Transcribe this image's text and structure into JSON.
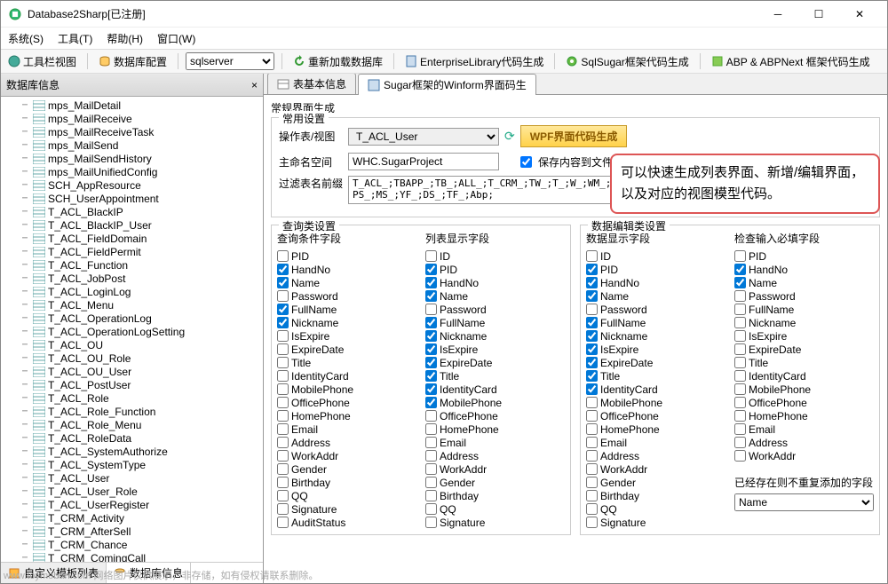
{
  "titlebar": {
    "title": "Database2Sharp[已注册]"
  },
  "menubar": {
    "items": [
      "系统(S)",
      "工具(T)",
      "帮助(H)",
      "窗口(W)"
    ]
  },
  "toolbar": {
    "toolbar_view": "工具栏视图",
    "db_config": "数据库配置",
    "db_select_value": "sqlserver",
    "reload_db": "重新加载数据库",
    "enterprise": "EnterpriseLibrary代码生成",
    "sqlsugar": "SqlSugar框架代码生成",
    "abp": "ABP & ABPNext 框架代码生成"
  },
  "sidebar": {
    "header": "数据库信息",
    "items": [
      "mps_MailDetail",
      "mps_MailReceive",
      "mps_MailReceiveTask",
      "mps_MailSend",
      "mps_MailSendHistory",
      "mps_MailUnifiedConfig",
      "SCH_AppResource",
      "SCH_UserAppointment",
      "T_ACL_BlackIP",
      "T_ACL_BlackIP_User",
      "T_ACL_FieldDomain",
      "T_ACL_FieldPermit",
      "T_ACL_Function",
      "T_ACL_JobPost",
      "T_ACL_LoginLog",
      "T_ACL_Menu",
      "T_ACL_OperationLog",
      "T_ACL_OperationLogSetting",
      "T_ACL_OU",
      "T_ACL_OU_Role",
      "T_ACL_OU_User",
      "T_ACL_PostUser",
      "T_ACL_Role",
      "T_ACL_Role_Function",
      "T_ACL_Role_Menu",
      "T_ACL_RoleData",
      "T_ACL_SystemAuthorize",
      "T_ACL_SystemType",
      "T_ACL_User",
      "T_ACL_User_Role",
      "T_ACL_UserRegister",
      "T_CRM_Activity",
      "T_CRM_AfterSell",
      "T_CRM_Chance",
      "T_CRM_ComingCall"
    ],
    "footer_tabs": {
      "custom_template": "自定义模板列表",
      "db_info": "数据库信息"
    }
  },
  "tabs": {
    "basic": "表基本信息",
    "sugar": "Sugar框架的Winform界面码生"
  },
  "panel": {
    "section_title": "常规界面生成",
    "group_title": "常用设置",
    "op_table_label": "操作表/视图",
    "op_table_value": "T_ACL_User",
    "wpf_btn": "WPF界面代码生成",
    "namespace_label": "主命名空间",
    "namespace_value": "WHC.SugarProject",
    "save_to_folder": "保存内容到文件夹中",
    "filter_label": "过滤表名前缀",
    "filter_value": "T_ACL_;TBAPP_;TB_;ALL_;T_CRM_;TW_;T_;W_;WM_;TBAPP_;MPS_;MS_;YF_;DS_;TF_;Abp;"
  },
  "fields": [
    "PID",
    "HandNo",
    "Name",
    "Password",
    "FullName",
    "Nickname",
    "IsExpire",
    "ExpireDate",
    "Title",
    "IdentityCard",
    "MobilePhone",
    "OfficePhone",
    "HomePhone",
    "Email",
    "Address",
    "WorkAddr",
    "Gender",
    "Birthday",
    "QQ",
    "Signature",
    "AuditStatus"
  ],
  "fields_short": [
    "ID",
    "PID",
    "HandNo",
    "Name",
    "Password",
    "FullName",
    "Nickname",
    "IsExpire",
    "ExpireDate",
    "Title",
    "IdentityCard",
    "MobilePhone",
    "OfficePhone",
    "HomePhone",
    "Email",
    "Address",
    "WorkAddr",
    "Gender",
    "Birthday",
    "QQ",
    "Signature"
  ],
  "fields_req": [
    "PID",
    "HandNo",
    "Name",
    "Password",
    "FullName",
    "Nickname",
    "IsExpire",
    "ExpireDate",
    "Title",
    "IdentityCard",
    "MobilePhone",
    "OfficePhone",
    "HomePhone",
    "Email",
    "Address",
    "WorkAddr"
  ],
  "col_groups": {
    "left_box": "查询类设置",
    "query_fields": "查询条件字段",
    "list_fields": "列表显示字段",
    "right_box": "数据编辑类设置",
    "edit_fields": "数据显示字段",
    "required_fields": "检查输入必填字段",
    "existing_label": "已经存在则不重复添加的字段",
    "existing_value": "Name"
  },
  "checked": {
    "query": [
      "HandNo",
      "Name",
      "FullName",
      "Nickname"
    ],
    "list": [
      "PID",
      "HandNo",
      "Name",
      "FullName",
      "Nickname",
      "IsExpire",
      "ExpireDate",
      "Title",
      "IdentityCard",
      "MobilePhone"
    ],
    "edit": [
      "PID",
      "HandNo",
      "Name",
      "FullName",
      "Nickname",
      "IsExpire",
      "ExpireDate",
      "Title",
      "IdentityCard"
    ],
    "req": [
      "HandNo",
      "Name"
    ]
  },
  "annotation": "可以快速生成列表界面、新增/编辑界面，以及对应的视图模型代码。",
  "footer_watermark": "www.toymoban.com 网络图片仅供展示，非存储，如有侵权请联系删除。"
}
